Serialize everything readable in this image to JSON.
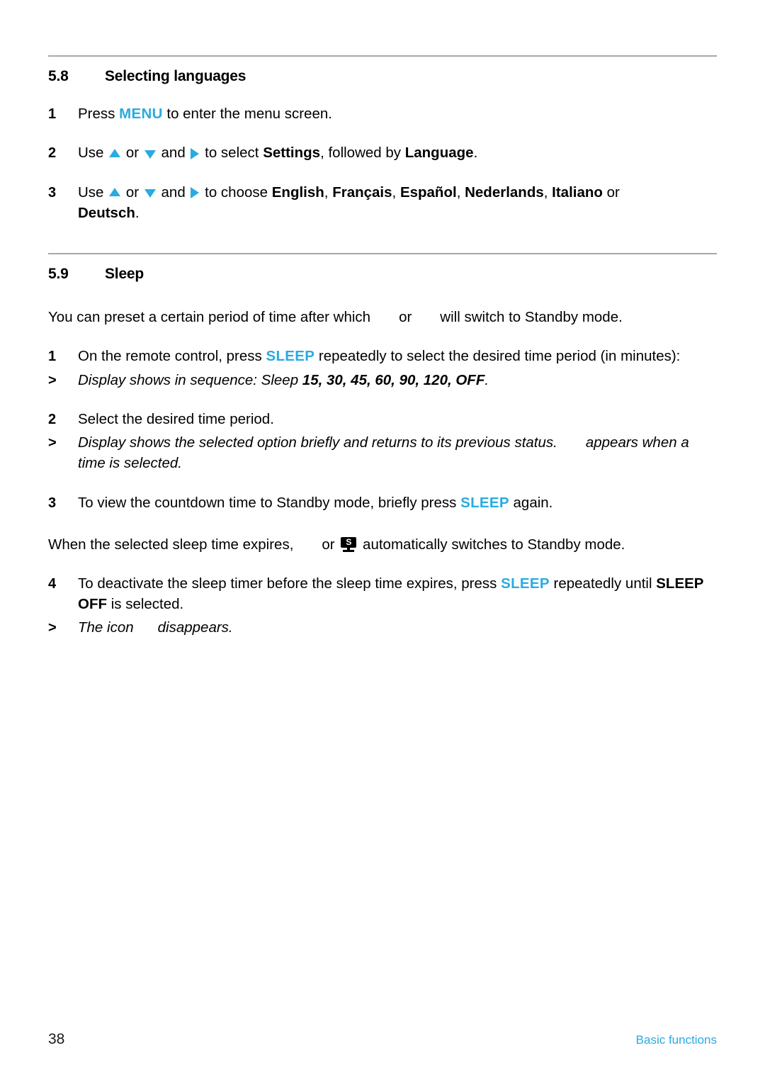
{
  "colors": {
    "accent_blue": "#29ABE2",
    "rule_gray": "#a8a8a8",
    "text_black": "#000000"
  },
  "sections": [
    {
      "number": "5.8",
      "title": "Selecting languages",
      "steps": [
        {
          "marker": "1",
          "parts": {
            "pre": "Press ",
            "key": "MENU",
            "post": " to enter the menu screen."
          }
        },
        {
          "marker": "2",
          "parts": {
            "use": "Use",
            "or": "or",
            "and": "and",
            "to_select": "to select",
            "bold1": "Settings",
            "mid": ", followed by",
            "bold2": "Language",
            "end": "."
          }
        },
        {
          "marker": "3",
          "parts": {
            "use": "Use",
            "or": "or",
            "and": "and",
            "to_choose": "to choose",
            "lang1": "English",
            "lang2": "Français",
            "lang3": "Español",
            "lang4": "Nederlands",
            "lang5": "Italiano",
            "conj": "or",
            "lang6": "Deutsch",
            "end": "."
          }
        }
      ]
    },
    {
      "number": "5.9",
      "title": "Sleep",
      "intro": {
        "pre": "You can preset a certain period of time after which",
        "or": "or",
        "post": "will switch to Standby mode."
      },
      "steps": [
        {
          "marker": "1",
          "parts": {
            "pre": "On the remote control, press ",
            "key": "SLEEP",
            "post": " repeatedly to select the desired time period (in minutes):"
          }
        },
        {
          "marker": ">",
          "italic": true,
          "parts": {
            "pre": "Display shows in sequence: Sleep ",
            "values": "15, 30, 45, 60, 90, 120, OFF",
            "post": "."
          }
        },
        {
          "marker": "2",
          "parts": {
            "text": "Select the desired time period."
          }
        },
        {
          "marker": ">",
          "italic": true,
          "parts": {
            "pre": "Display shows the selected option briefly and returns to its previous status.",
            "post": "appears when a time is selected."
          }
        },
        {
          "marker": "3",
          "parts": {
            "pre": "To view the countdown time to Standby mode, briefly press ",
            "key": "SLEEP",
            "post": " again."
          }
        }
      ],
      "standby_paragraph": {
        "pre": "When the selected sleep time expires,",
        "or": "or",
        "post": "automatically switches to Standby mode."
      },
      "final_steps": [
        {
          "marker": "4",
          "parts": {
            "pre": "To deactivate the sleep timer before the sleep time expires, press ",
            "key": "SLEEP",
            "mid": " repeatedly until ",
            "bold": "SLEEP OFF",
            "post": " is selected."
          }
        },
        {
          "marker": ">",
          "italic": true,
          "parts": {
            "pre": "The icon",
            "post": "disappears."
          }
        }
      ]
    }
  ],
  "icons": {
    "arrow_up": "triangle-up-icon",
    "arrow_down": "triangle-down-icon",
    "arrow_right": "triangle-right-icon",
    "standby_tv": "standby-tv-icon",
    "standby_tv_letter": "S"
  },
  "footer": {
    "page_number": "38",
    "label": "Basic functions"
  }
}
